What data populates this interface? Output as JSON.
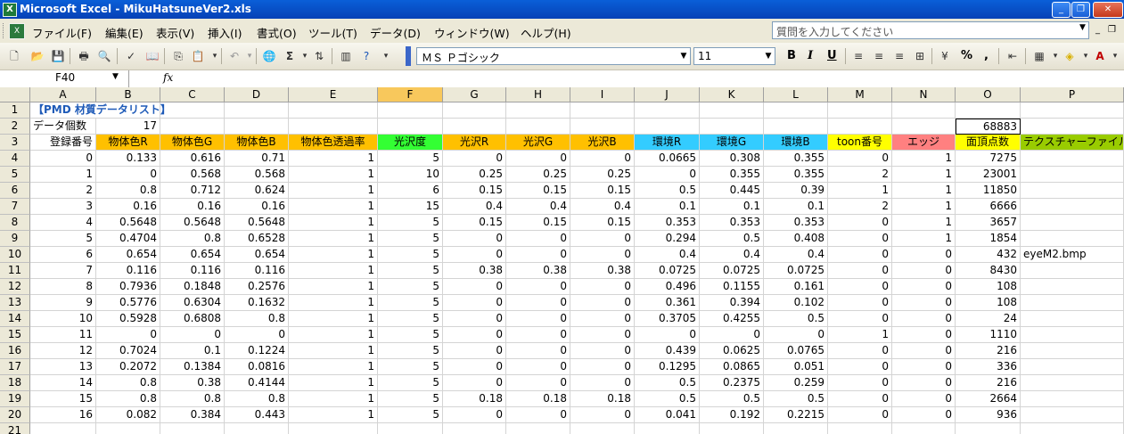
{
  "window": {
    "title": "Microsoft Excel - MikuHatsuneVer2.xls",
    "app_icon": "excel-icon",
    "minimize": "_",
    "restore": "❐",
    "close": "✕"
  },
  "menu": {
    "items": [
      "ファイル(F)",
      "編集(E)",
      "表示(V)",
      "挿入(I)",
      "書式(O)",
      "ツール(T)",
      "データ(D)",
      "ウィンドウ(W)",
      "ヘルプ(H)"
    ],
    "help_placeholder": "質問を入力してください",
    "mini_minimize": "_",
    "mini_restore": "❐",
    "mini_close": "✕"
  },
  "toolbar": {
    "font_name": "ＭＳ Ｐゴシック",
    "font_size": "11",
    "bold": "B",
    "italic": "I",
    "underline": "U",
    "percent": "%",
    "comma": ","
  },
  "formula_bar": {
    "name_box": "F40",
    "fx": "fx",
    "content": ""
  },
  "colors": {
    "header_active": "#f8c85c",
    "orange": "#ffc000",
    "green": "#33ff33",
    "cyan": "#33ccff",
    "yellow": "#ffff00",
    "pink": "#ff8080",
    "lime": "#99cc00"
  },
  "sheet": {
    "columns": [
      "A",
      "B",
      "C",
      "D",
      "E",
      "F",
      "G",
      "H",
      "I",
      "J",
      "K",
      "L",
      "M",
      "N",
      "O",
      "P"
    ],
    "active_column": "F",
    "rows": [
      {
        "n": "1",
        "cells": [
          {
            "c": 0,
            "v": "【PMD 材質データリスト】",
            "overflow": true,
            "style": "title"
          }
        ]
      },
      {
        "n": "2",
        "cells": [
          {
            "c": 0,
            "v": "データ個数"
          },
          {
            "c": 1,
            "v": "17",
            "num": true
          },
          {
            "c": 14,
            "v": "68883",
            "num": true,
            "boxed": true
          }
        ]
      },
      {
        "n": "3",
        "header": true,
        "cells": [
          {
            "c": 0,
            "v": "登録番号",
            "num": true
          },
          {
            "c": 1,
            "v": "物体色R",
            "bg": "orange"
          },
          {
            "c": 2,
            "v": "物体色G",
            "bg": "orange"
          },
          {
            "c": 3,
            "v": "物体色B",
            "bg": "orange"
          },
          {
            "c": 4,
            "v": "物体色透過率",
            "bg": "orange"
          },
          {
            "c": 5,
            "v": "光沢度",
            "bg": "green"
          },
          {
            "c": 6,
            "v": "光沢R",
            "bg": "orange"
          },
          {
            "c": 7,
            "v": "光沢G",
            "bg": "orange"
          },
          {
            "c": 8,
            "v": "光沢B",
            "bg": "orange"
          },
          {
            "c": 9,
            "v": "環境R",
            "bg": "cyan"
          },
          {
            "c": 10,
            "v": "環境G",
            "bg": "cyan"
          },
          {
            "c": 11,
            "v": "環境B",
            "bg": "cyan"
          },
          {
            "c": 12,
            "v": "toon番号",
            "bg": "yellow"
          },
          {
            "c": 13,
            "v": "エッジ",
            "bg": "pink"
          },
          {
            "c": 14,
            "v": "面頂点数",
            "bg": "yellow"
          },
          {
            "c": 15,
            "v": "テクスチャーファイル",
            "bg": "lime"
          }
        ]
      },
      {
        "n": "4",
        "vals": [
          "0",
          "0.133",
          "0.616",
          "0.71",
          "1",
          "5",
          "0",
          "0",
          "0",
          "0.0665",
          "0.308",
          "0.355",
          "0",
          "1",
          "7275",
          ""
        ]
      },
      {
        "n": "5",
        "vals": [
          "1",
          "0",
          "0.568",
          "0.568",
          "1",
          "10",
          "0.25",
          "0.25",
          "0.25",
          "0",
          "0.355",
          "0.355",
          "2",
          "1",
          "23001",
          ""
        ]
      },
      {
        "n": "6",
        "vals": [
          "2",
          "0.8",
          "0.712",
          "0.624",
          "1",
          "6",
          "0.15",
          "0.15",
          "0.15",
          "0.5",
          "0.445",
          "0.39",
          "1",
          "1",
          "11850",
          ""
        ]
      },
      {
        "n": "7",
        "vals": [
          "3",
          "0.16",
          "0.16",
          "0.16",
          "1",
          "15",
          "0.4",
          "0.4",
          "0.4",
          "0.1",
          "0.1",
          "0.1",
          "2",
          "1",
          "6666",
          ""
        ]
      },
      {
        "n": "8",
        "vals": [
          "4",
          "0.5648",
          "0.5648",
          "0.5648",
          "1",
          "5",
          "0.15",
          "0.15",
          "0.15",
          "0.353",
          "0.353",
          "0.353",
          "0",
          "1",
          "3657",
          ""
        ]
      },
      {
        "n": "9",
        "vals": [
          "5",
          "0.4704",
          "0.8",
          "0.6528",
          "1",
          "5",
          "0",
          "0",
          "0",
          "0.294",
          "0.5",
          "0.408",
          "0",
          "1",
          "1854",
          ""
        ]
      },
      {
        "n": "10",
        "vals": [
          "6",
          "0.654",
          "0.654",
          "0.654",
          "1",
          "5",
          "0",
          "0",
          "0",
          "0.4",
          "0.4",
          "0.4",
          "0",
          "0",
          "432",
          "eyeM2.bmp"
        ]
      },
      {
        "n": "11",
        "vals": [
          "7",
          "0.116",
          "0.116",
          "0.116",
          "1",
          "5",
          "0.38",
          "0.38",
          "0.38",
          "0.0725",
          "0.0725",
          "0.0725",
          "0",
          "0",
          "8430",
          ""
        ]
      },
      {
        "n": "12",
        "vals": [
          "8",
          "0.7936",
          "0.1848",
          "0.2576",
          "1",
          "5",
          "0",
          "0",
          "0",
          "0.496",
          "0.1155",
          "0.161",
          "0",
          "0",
          "108",
          ""
        ]
      },
      {
        "n": "13",
        "vals": [
          "9",
          "0.5776",
          "0.6304",
          "0.1632",
          "1",
          "5",
          "0",
          "0",
          "0",
          "0.361",
          "0.394",
          "0.102",
          "0",
          "0",
          "108",
          ""
        ]
      },
      {
        "n": "14",
        "vals": [
          "10",
          "0.5928",
          "0.6808",
          "0.8",
          "1",
          "5",
          "0",
          "0",
          "0",
          "0.3705",
          "0.4255",
          "0.5",
          "0",
          "0",
          "24",
          ""
        ]
      },
      {
        "n": "15",
        "vals": [
          "11",
          "0",
          "0",
          "0",
          "1",
          "5",
          "0",
          "0",
          "0",
          "0",
          "0",
          "0",
          "1",
          "0",
          "1110",
          ""
        ]
      },
      {
        "n": "16",
        "vals": [
          "12",
          "0.7024",
          "0.1",
          "0.1224",
          "1",
          "5",
          "0",
          "0",
          "0",
          "0.439",
          "0.0625",
          "0.0765",
          "0",
          "0",
          "216",
          ""
        ]
      },
      {
        "n": "17",
        "vals": [
          "13",
          "0.2072",
          "0.1384",
          "0.0816",
          "1",
          "5",
          "0",
          "0",
          "0",
          "0.1295",
          "0.0865",
          "0.051",
          "0",
          "0",
          "336",
          ""
        ]
      },
      {
        "n": "18",
        "vals": [
          "14",
          "0.8",
          "0.38",
          "0.4144",
          "1",
          "5",
          "0",
          "0",
          "0",
          "0.5",
          "0.2375",
          "0.259",
          "0",
          "0",
          "216",
          ""
        ]
      },
      {
        "n": "19",
        "vals": [
          "15",
          "0.8",
          "0.8",
          "0.8",
          "1",
          "5",
          "0.18",
          "0.18",
          "0.18",
          "0.5",
          "0.5",
          "0.5",
          "0",
          "0",
          "2664",
          ""
        ]
      },
      {
        "n": "20",
        "vals": [
          "16",
          "0.082",
          "0.384",
          "0.443",
          "1",
          "5",
          "0",
          "0",
          "0",
          "0.041",
          "0.192",
          "0.2215",
          "0",
          "0",
          "936",
          ""
        ]
      },
      {
        "n": "21",
        "vals": [
          "",
          "",
          "",
          "",
          "",
          "",
          "",
          "",
          "",
          "",
          "",
          "",
          "",
          "",
          "",
          ""
        ]
      }
    ]
  }
}
